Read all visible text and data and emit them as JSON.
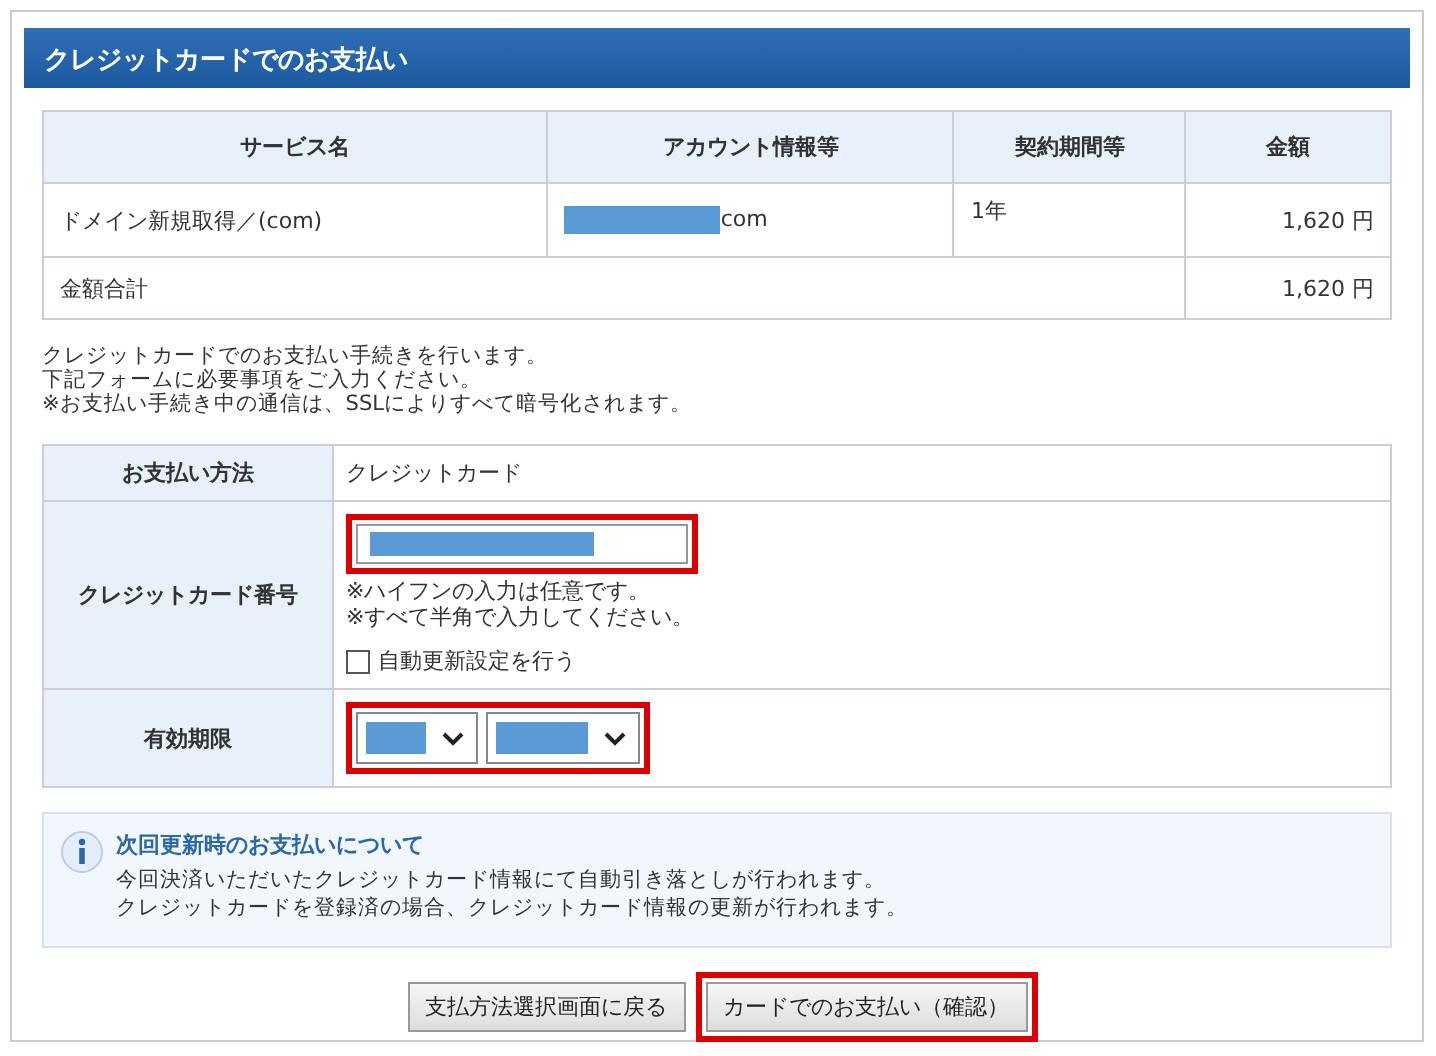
{
  "title": "クレジットカードでのお支払い",
  "summary": {
    "columns": [
      "サービス名",
      "アカウント情報等",
      "契約期間等",
      "金額"
    ],
    "rows": [
      {
        "service": "ドメイン新規取得／(com)",
        "account_suffix": "com",
        "term": "1年",
        "amount": "1,620 円"
      }
    ],
    "total": {
      "label": "金額合計",
      "amount": "1,620 円"
    }
  },
  "intro": [
    "クレジットカードでのお支払い手続きを行います。",
    "下記フォームに必要事項をご入力ください。",
    "※お支払い手続き中の通信は、SSLによりすべて暗号化されます。"
  ],
  "form": [
    {
      "kind": "text",
      "label": "お支払い方法",
      "value": "クレジットカード"
    },
    {
      "kind": "card",
      "label": "クレジットカード番号",
      "highlighted": true,
      "notes": [
        "※ハイフンの入力は任意です。",
        "※すべて半角で入力してください。"
      ],
      "auto_renew": {
        "label": "自動更新設定を行う",
        "checked": false
      }
    },
    {
      "kind": "expiry",
      "label": "有効期限",
      "highlighted": true
    }
  ],
  "info": {
    "title": "次回更新時のお支払いについて",
    "lines": [
      "今回決済いただいたクレジットカード情報にて自動引き落としが行われます。",
      "クレジットカードを登録済の場合、クレジットカード情報の更新が行われます。"
    ]
  },
  "buttons": [
    {
      "label": "支払方法選択画面に戻る",
      "highlighted": false
    },
    {
      "label": "カードでのお支払い（確認）",
      "highlighted": true
    }
  ]
}
